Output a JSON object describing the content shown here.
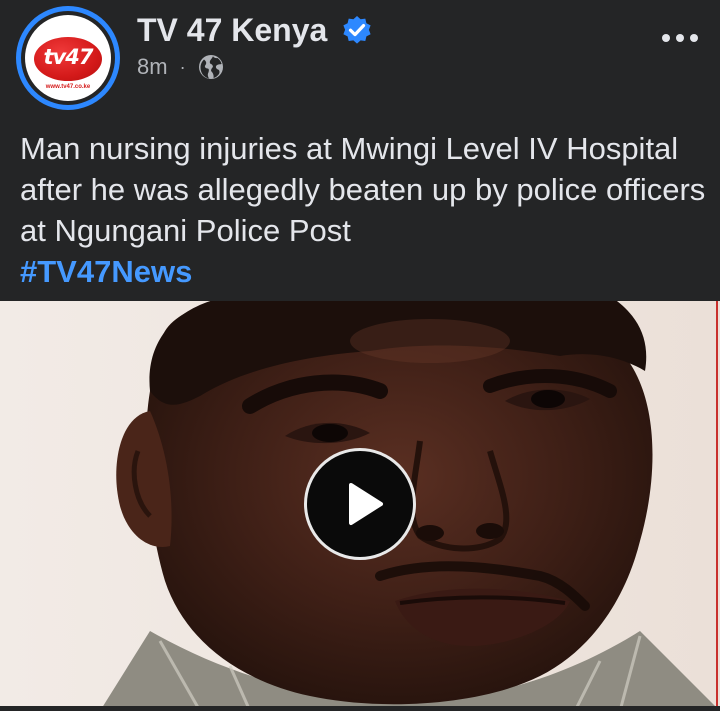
{
  "post": {
    "page_name": "TV 47 Kenya",
    "timestamp": "8m",
    "separator": "·",
    "caption": "Man nursing injuries at Mwingi Level IV Hospital after he was allegedly beaten up by police officers at Ngungani Police Post",
    "hashtag": "#TV47News"
  },
  "avatar": {
    "logo_text": "tv47",
    "url_text": "www.tv47.co.ke"
  },
  "icons": {
    "verified": "verified-badge-icon",
    "audience": "globe-icon",
    "more": "more-options-icon",
    "play": "play-icon"
  },
  "colors": {
    "background": "#242526",
    "text_primary": "#e4e6eb",
    "text_secondary": "#b0b3b8",
    "hashtag": "#4599ff",
    "verified": "#2d88ff",
    "brand_red": "#d41a1a"
  }
}
